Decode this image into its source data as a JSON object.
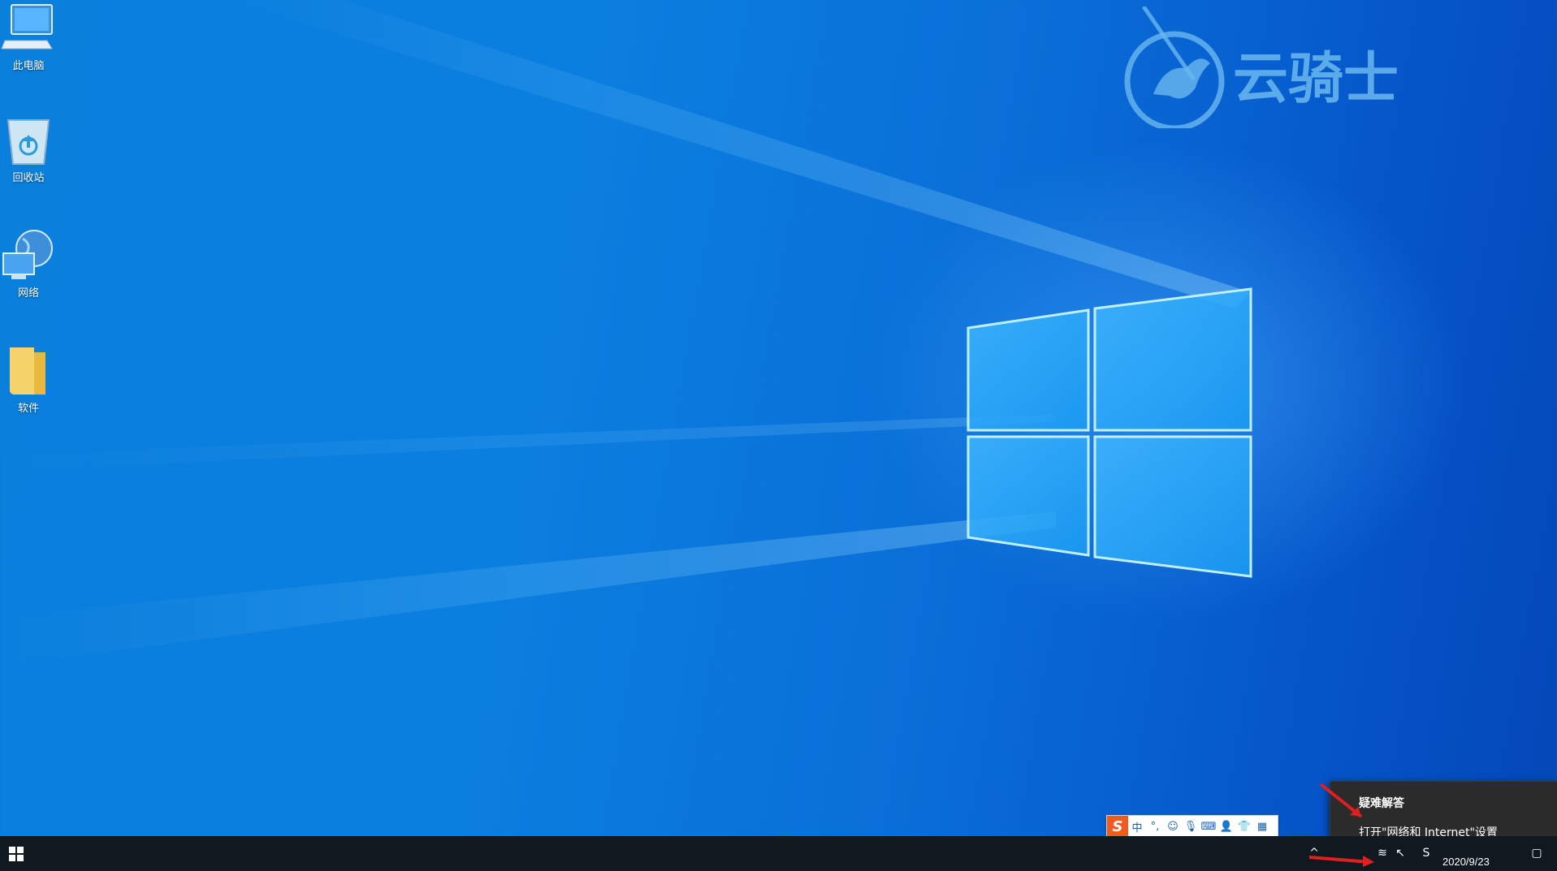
{
  "desktop": {
    "icons": [
      {
        "label": "此电脑",
        "icon": "this-pc-icon"
      },
      {
        "label": "回收站",
        "icon": "recycle-bin-icon"
      },
      {
        "label": "网络",
        "icon": "network-icon"
      },
      {
        "label": "软件",
        "icon": "folder-icon"
      }
    ]
  },
  "watermark": {
    "text": "云骑士",
    "color": "#6ab8f0"
  },
  "ime": {
    "logo": "S",
    "mode": "中",
    "punct": "°,"
  },
  "context_menu": {
    "items": [
      {
        "label": "疑难解答"
      },
      {
        "label": "打开\"网络和 Internet\"设置"
      }
    ]
  },
  "taskbar": {
    "date": "2020/9/23",
    "colors": {
      "bg": "#101820",
      "accent": "#0a7fdc",
      "annotation": "#e02020"
    }
  }
}
